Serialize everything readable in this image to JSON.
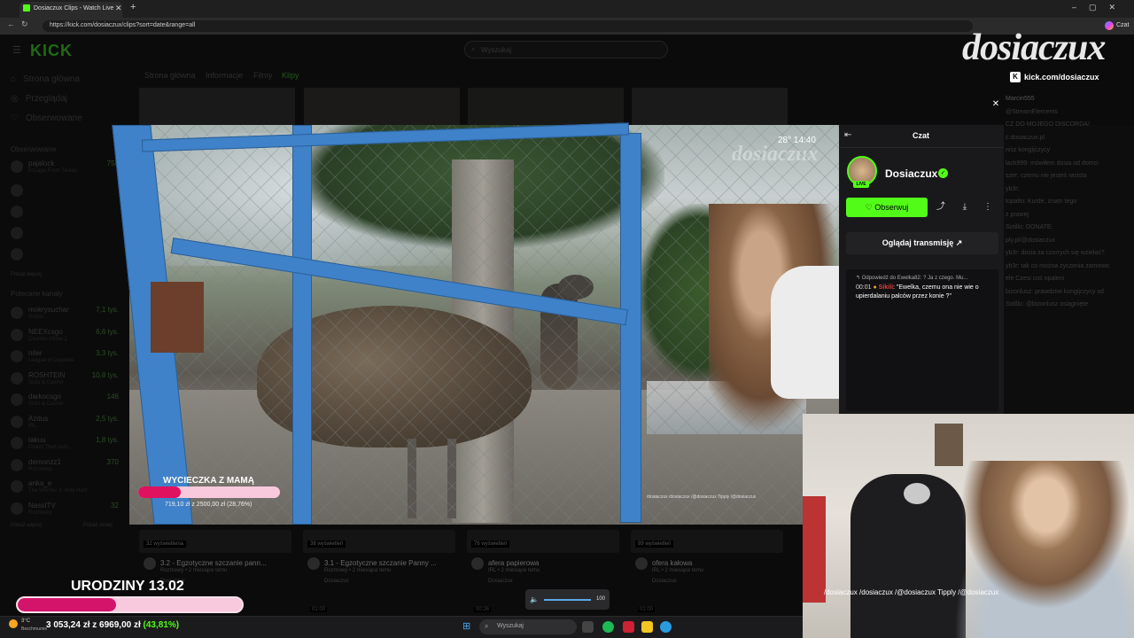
{
  "browser": {
    "tab_title": "Dosiaczux Clips - Watch Live",
    "url": "https://kick.com/dosiaczux/clips?sort=date&range=all",
    "copilot_label": "Czat"
  },
  "kick": {
    "logo": "KICK",
    "search_placeholder": "Wyszukaj",
    "nav": [
      {
        "label": "Strona główna",
        "icon": "home-icon"
      },
      {
        "label": "Przeglądaj",
        "icon": "compass-icon"
      },
      {
        "label": "Obserwowane",
        "icon": "heart-icon"
      }
    ],
    "followed_heading": "Obserwowane",
    "followed": [
      {
        "name": "pajalock",
        "game": "Escape From Tarkov",
        "count": "758"
      }
    ],
    "show_more": "Pokaż więcej",
    "recommended_heading": "Polecane kanały",
    "recommended": [
      {
        "name": "mokrysuchar",
        "game": "Gothic",
        "count": "7,1 tys."
      },
      {
        "name": "NEEXcsgo",
        "game": "Counter-Strike 2",
        "count": "6,6 tys."
      },
      {
        "name": "niter",
        "game": "League of Legends",
        "count": "3,3 tys."
      },
      {
        "name": "ROSHTEIN",
        "game": "Slots & Casino",
        "count": "10,8 tys."
      },
      {
        "name": "darkocsgo",
        "game": "Slots & Casino",
        "count": "146"
      },
      {
        "name": "Azdus",
        "game": "IRL",
        "count": "2,5 tys."
      },
      {
        "name": "takuu",
        "game": "Grand Theft Auto ...",
        "count": "1,8 tys."
      },
      {
        "name": "demonzz1",
        "game": "Rozmowy",
        "count": "370"
      },
      {
        "name": "anka_e",
        "game": "The Witcher 3: Wild Hunt",
        "count": ""
      },
      {
        "name": "NassITV",
        "game": "Rozmowy",
        "count": "32"
      }
    ],
    "show_less": "Pokaż mniej",
    "channel_tabs": [
      "Strona główna",
      "Informacje",
      "Filmy",
      "Klipy"
    ],
    "clips": [
      {
        "views": "32 wyświetlenia",
        "title": "3.2 - Egzotyczne szczanie pann...",
        "sub": "Rozmowy • 2 miesiące temu",
        "channel": "Dosiaczux"
      },
      {
        "views": "38 wyświetleń",
        "title": "3.1 - Egzotyczne szczanie Panny ...",
        "sub": "Rozmowy • 2 miesiące temu",
        "channel": "Dosiaczux"
      },
      {
        "views": "76 wyświetleń",
        "title": "afera papierowa",
        "sub": "IRL • 2 miesiące temu",
        "channel": "Dosiaczux"
      },
      {
        "views": "89 wyświetleń",
        "title": "ofera kałowa",
        "sub": "IRL • 2 miesiące temu",
        "channel": "Dosiaczux"
      }
    ],
    "clip_durations": [
      "01:00",
      "00:26",
      "01:00"
    ]
  },
  "modal": {
    "video": {
      "temperature_time": "28° 14:40",
      "watermark": "dosiaczux",
      "goal_label": "WYCIECZKA Z MAMĄ",
      "goal_progress": 0.3,
      "goal_text": "719,10 zł z 2500,00 zł (28,76%)",
      "socials": "/dosiaczux  /dosiaczux  /@dosiaczux  Tipply /@dosiaczux"
    },
    "chat": {
      "title": "Czat",
      "channel": "Dosiaczux",
      "live_badge": "LIVE",
      "follow_label": "Obserwuj",
      "watch_label": "Oglądaj transmisję",
      "reply_to": "Odpowiedź do Ewelka82: ? Ja z czego. Mu...",
      "message_time": "00:01",
      "message_user": "Sikili",
      "message_text": "\"Ewelka, czemu ona nie wie o upierdalaniu palców przez konie ?\""
    }
  },
  "overlay": {
    "watermark": "dosiaczux",
    "kick_url": "kick.com/dosiaczux",
    "right_chat": [
      "Marcin555",
      "@StreamElements",
      "CZ DO MOJEGO DISCORDA!",
      "c.dosiaczux.pl",
      "nisz kongijczycy",
      "lack999: mówiłem dosia od domci",
      "szer: czemu nie jesteś rasista",
      "yb3r:",
      "topalto: Kurde, znam tego",
      "z prawej",
      "Sotillo: DONATE:",
      "ply.pl/@dosiaczux",
      "yb3r: dosia za czorrych się wziełaś?",
      "yb3r: tak co można życzenia zamowic",
      "ele Czesi coś opaleni",
      "bizonlusz: prawdziwi kongijczycy xd",
      "Sotillo: @bizonlusz osiągnięte"
    ],
    "birthday_label": "URODZINY 13.02",
    "birthday_progress": 0.4381,
    "webcam_socials": "/dosiaczux  /dosiaczux  /@dosiaczux  Tipply /@dosiaczux"
  },
  "taskbar": {
    "weather_temp": "3°C",
    "weather_desc": "Bezchmurnie",
    "goal_text": "3 053,24 zł z 6969,00 zł",
    "goal_pct": "(43,81%)",
    "search_placeholder": "Wyszukaj",
    "volume_value": "100"
  }
}
